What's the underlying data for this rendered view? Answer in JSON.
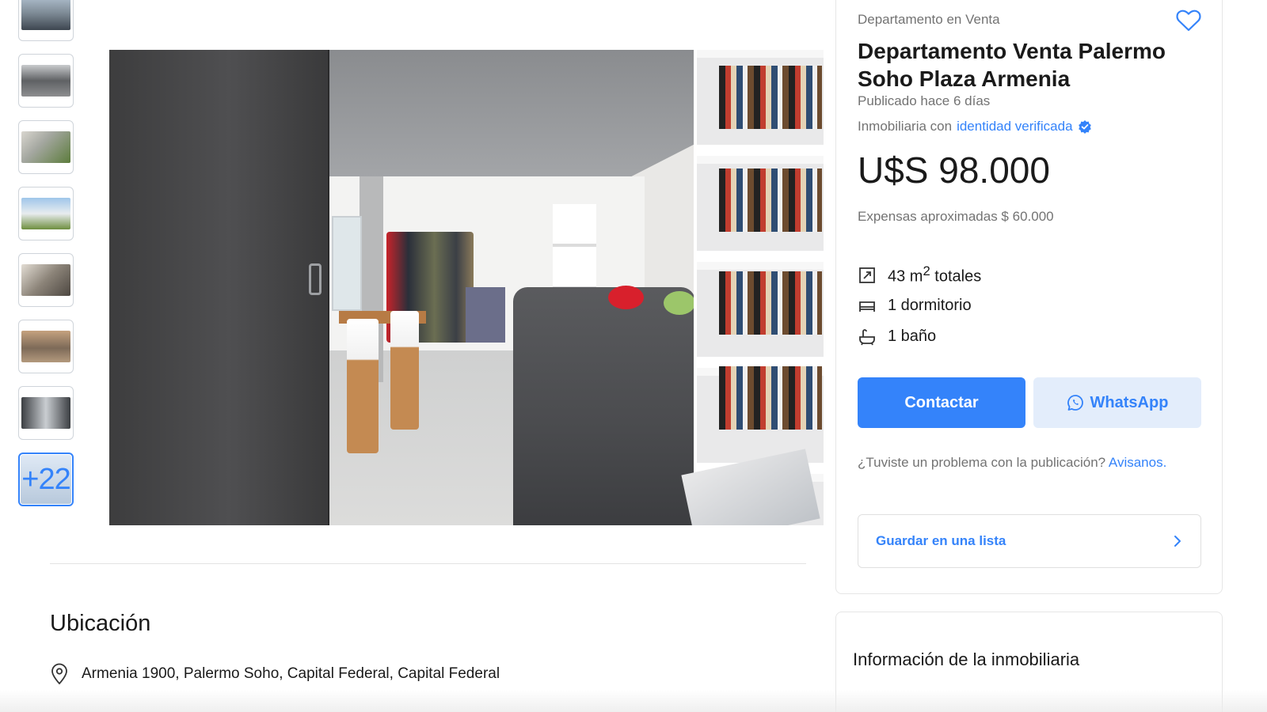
{
  "gallery": {
    "thumbnails": [
      {
        "icon": "photo-thumbnail"
      },
      {
        "icon": "photo-thumbnail"
      },
      {
        "icon": "photo-thumbnail"
      },
      {
        "icon": "photo-thumbnail"
      },
      {
        "icon": "photo-thumbnail"
      },
      {
        "icon": "photo-thumbnail"
      },
      {
        "icon": "photo-thumbnail"
      }
    ],
    "more_label": "+22"
  },
  "location": {
    "title": "Ubicación",
    "address": "Armenia 1900, Palermo Soho, Capital Federal, Capital Federal",
    "icon": "map-pin-icon"
  },
  "listing": {
    "subtitle": "Departamento en Venta",
    "title": "Departamento Venta Palermo Soho Plaza Armenia",
    "published": "Publicado hace 6 días",
    "verified_prefix": "Inmobiliaria con",
    "verified_link": "identidad verificada",
    "price": "U$S 98.000",
    "expensas": "Expensas aproximadas $ 60.000",
    "features": [
      {
        "icon": "area-icon",
        "text_main": "43 m",
        "text_sup": "2",
        "text_after": " totales"
      },
      {
        "icon": "bed-icon",
        "text": "1 dormitorio"
      },
      {
        "icon": "bathtub-icon",
        "text": "1 baño"
      }
    ],
    "contact_label": "Contactar",
    "whatsapp_label": "WhatsApp",
    "problem_text": "¿Tuviste un problema con la publicación?",
    "problem_link": "Avisanos.",
    "save_list_label": "Guardar en una lista"
  },
  "agency": {
    "title": "Información de la inmobiliaria"
  },
  "colors": {
    "accent": "#3483fa",
    "accent_light": "#e3edfb",
    "muted_text": "#737373"
  }
}
